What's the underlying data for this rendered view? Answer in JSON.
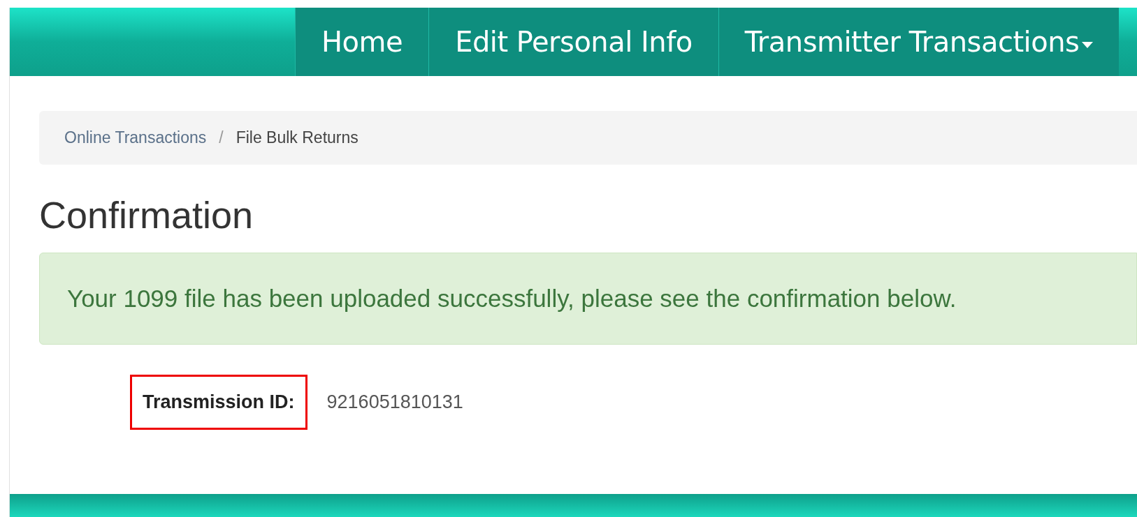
{
  "navbar": {
    "items": [
      {
        "label": "Home",
        "kind": "link"
      },
      {
        "label": "Edit Personal Info",
        "kind": "link"
      },
      {
        "label": "Transmitter Transactions",
        "kind": "dropdown"
      }
    ]
  },
  "breadcrumb": [
    "Online Transactions",
    "File Bulk Returns"
  ],
  "breadcrumb_separator": "/",
  "heading": "Confirmation",
  "alert": "Your 1099 file has been uploaded successfully, please see the confirmation below.",
  "field": {
    "label": "Transmission ID:",
    "value": "9216051810131",
    "highlighted": true
  }
}
